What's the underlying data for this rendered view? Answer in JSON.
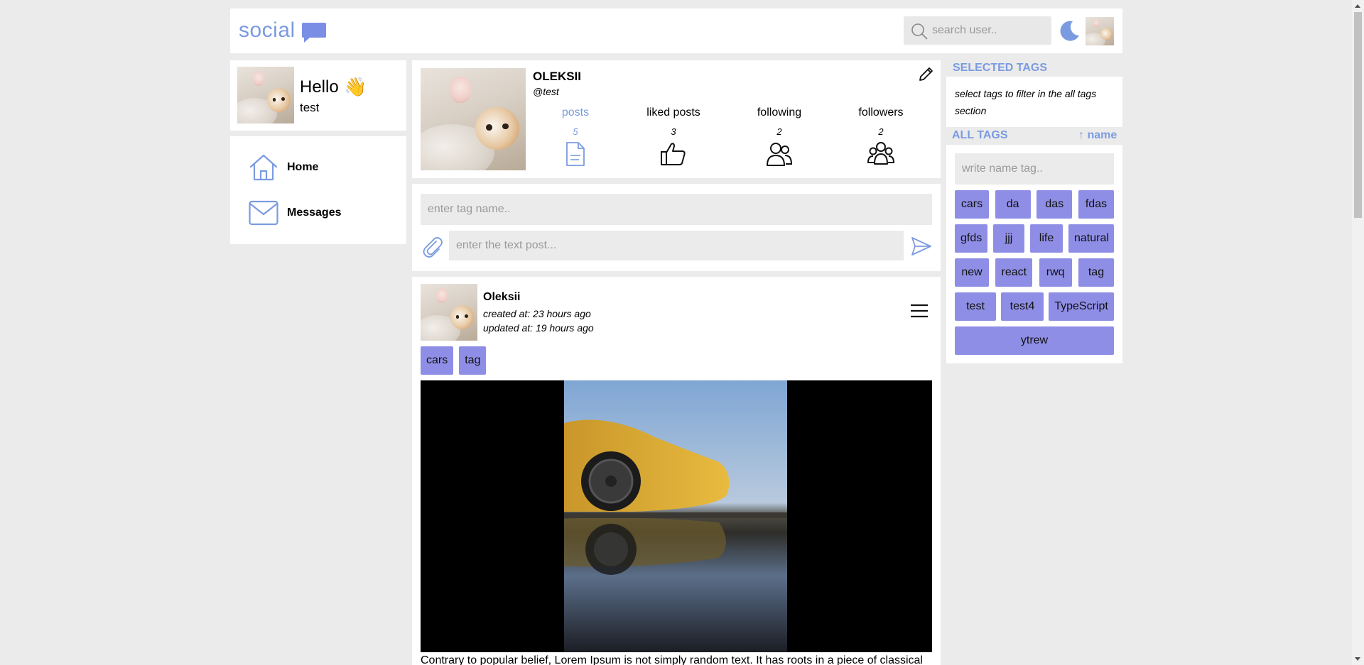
{
  "header": {
    "logo_text": "social",
    "search_placeholder": "search user..",
    "icons": [
      "chat-bubble-icon",
      "search-icon",
      "moon-icon",
      "avatar"
    ]
  },
  "hello": {
    "greeting": "Hello",
    "wave": "👋",
    "username": "test"
  },
  "nav": {
    "items": [
      {
        "label": "Home",
        "icon": "home-icon"
      },
      {
        "label": "Messages",
        "icon": "mail-icon"
      }
    ]
  },
  "profile": {
    "name": "OLEKSII",
    "handle": "@test",
    "stats": [
      {
        "label": "posts",
        "count": "5",
        "icon": "document-icon",
        "active": true
      },
      {
        "label": "liked posts",
        "count": "3",
        "icon": "thumbs-up-icon",
        "active": false
      },
      {
        "label": "following",
        "count": "2",
        "icon": "users-icon",
        "active": false
      },
      {
        "label": "followers",
        "count": "2",
        "icon": "group-icon",
        "active": false
      }
    ]
  },
  "new_post": {
    "tag_placeholder": "enter tag name..",
    "text_placeholder": "enter the text post..."
  },
  "post": {
    "author": "Oleksii",
    "created": "created at: 23 hours ago",
    "updated": "updated at: 19 hours ago",
    "tags": [
      "cars",
      "tag"
    ],
    "text": "Contrary to popular belief, Lorem Ipsum is not simply random text. It has roots in a piece of classical"
  },
  "sidebar": {
    "selected_title": "SELECTED TAGS",
    "selected_hint": "select tags to filter in the all tags section",
    "all_title": "ALL TAGS",
    "sort_label": "↑ name",
    "tag_search_placeholder": "write name tag..",
    "tag_rows": [
      [
        "cars",
        "da",
        "das",
        "fdas"
      ],
      [
        "gfds",
        "jjj",
        "life",
        "natural"
      ],
      [
        "new",
        "react",
        "rwq",
        "tag"
      ],
      [
        "test",
        "test4",
        "TypeScript"
      ],
      [
        "ytrew"
      ]
    ]
  },
  "colors": {
    "accent": "#7b9be0",
    "tag_bg": "#8f8ee6",
    "page_bg": "#ebebeb",
    "card_bg": "#ffffff"
  }
}
